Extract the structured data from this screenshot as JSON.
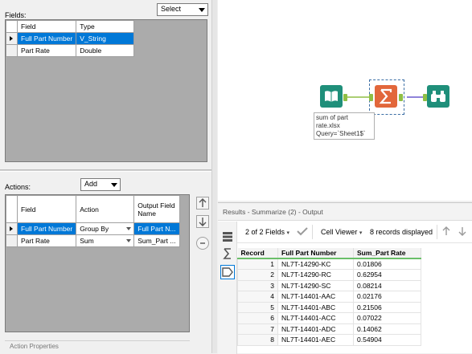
{
  "fields_panel": {
    "label": "Fields:",
    "select_dropdown": "Select",
    "columns": [
      "Field",
      "Type"
    ],
    "rows": [
      {
        "field": "Full Part Number",
        "type": "V_String"
      },
      {
        "field": "Part Rate",
        "type": "Double"
      }
    ]
  },
  "actions_panel": {
    "label": "Actions:",
    "add_dropdown": "Add",
    "columns": [
      "Field",
      "Action",
      "Output Field Name"
    ],
    "rows": [
      {
        "field": "Full Part Number",
        "action": "Group By",
        "output": "Full Part N..."
      },
      {
        "field": "Part Rate",
        "action": "Sum",
        "output": "Sum_Part ..."
      }
    ],
    "action_properties_label": "Action Properties"
  },
  "canvas": {
    "input_annotation": [
      "sum of part",
      "rate.xlsx",
      "Query=`Sheet1$`"
    ],
    "tools": [
      "book-icon",
      "summarize-sigma-icon",
      "binoculars-icon"
    ],
    "colors": {
      "input": "#1f8f7a",
      "summarize": "#e2673b",
      "browse": "#1f8f7a",
      "connector": "#8fbf45"
    }
  },
  "results": {
    "title": "Results - Summarize (2) - Output",
    "fields_count": "2 of 2 Fields",
    "viewer": "Cell Viewer",
    "records_displayed": "8 records displayed",
    "columns": [
      "Record",
      "Full Part Number",
      "Sum_Part Rate"
    ],
    "rows": [
      {
        "record": "1",
        "part": "NL7T-14290-KC",
        "sum": "0.01806"
      },
      {
        "record": "2",
        "part": "NL7T-14290-RC",
        "sum": "0.62954"
      },
      {
        "record": "3",
        "part": "NL7T-14290-SC",
        "sum": "0.08214"
      },
      {
        "record": "4",
        "part": "NL7T-14401-AAC",
        "sum": "0.02176"
      },
      {
        "record": "5",
        "part": "NL7T-14401-ABC",
        "sum": "0.21506"
      },
      {
        "record": "6",
        "part": "NL7T-14401-ACC",
        "sum": "0.07022"
      },
      {
        "record": "7",
        "part": "NL7T-14401-ADC",
        "sum": "0.14062"
      },
      {
        "record": "8",
        "part": "NL7T-14401-AEC",
        "sum": "0.54904"
      }
    ]
  }
}
